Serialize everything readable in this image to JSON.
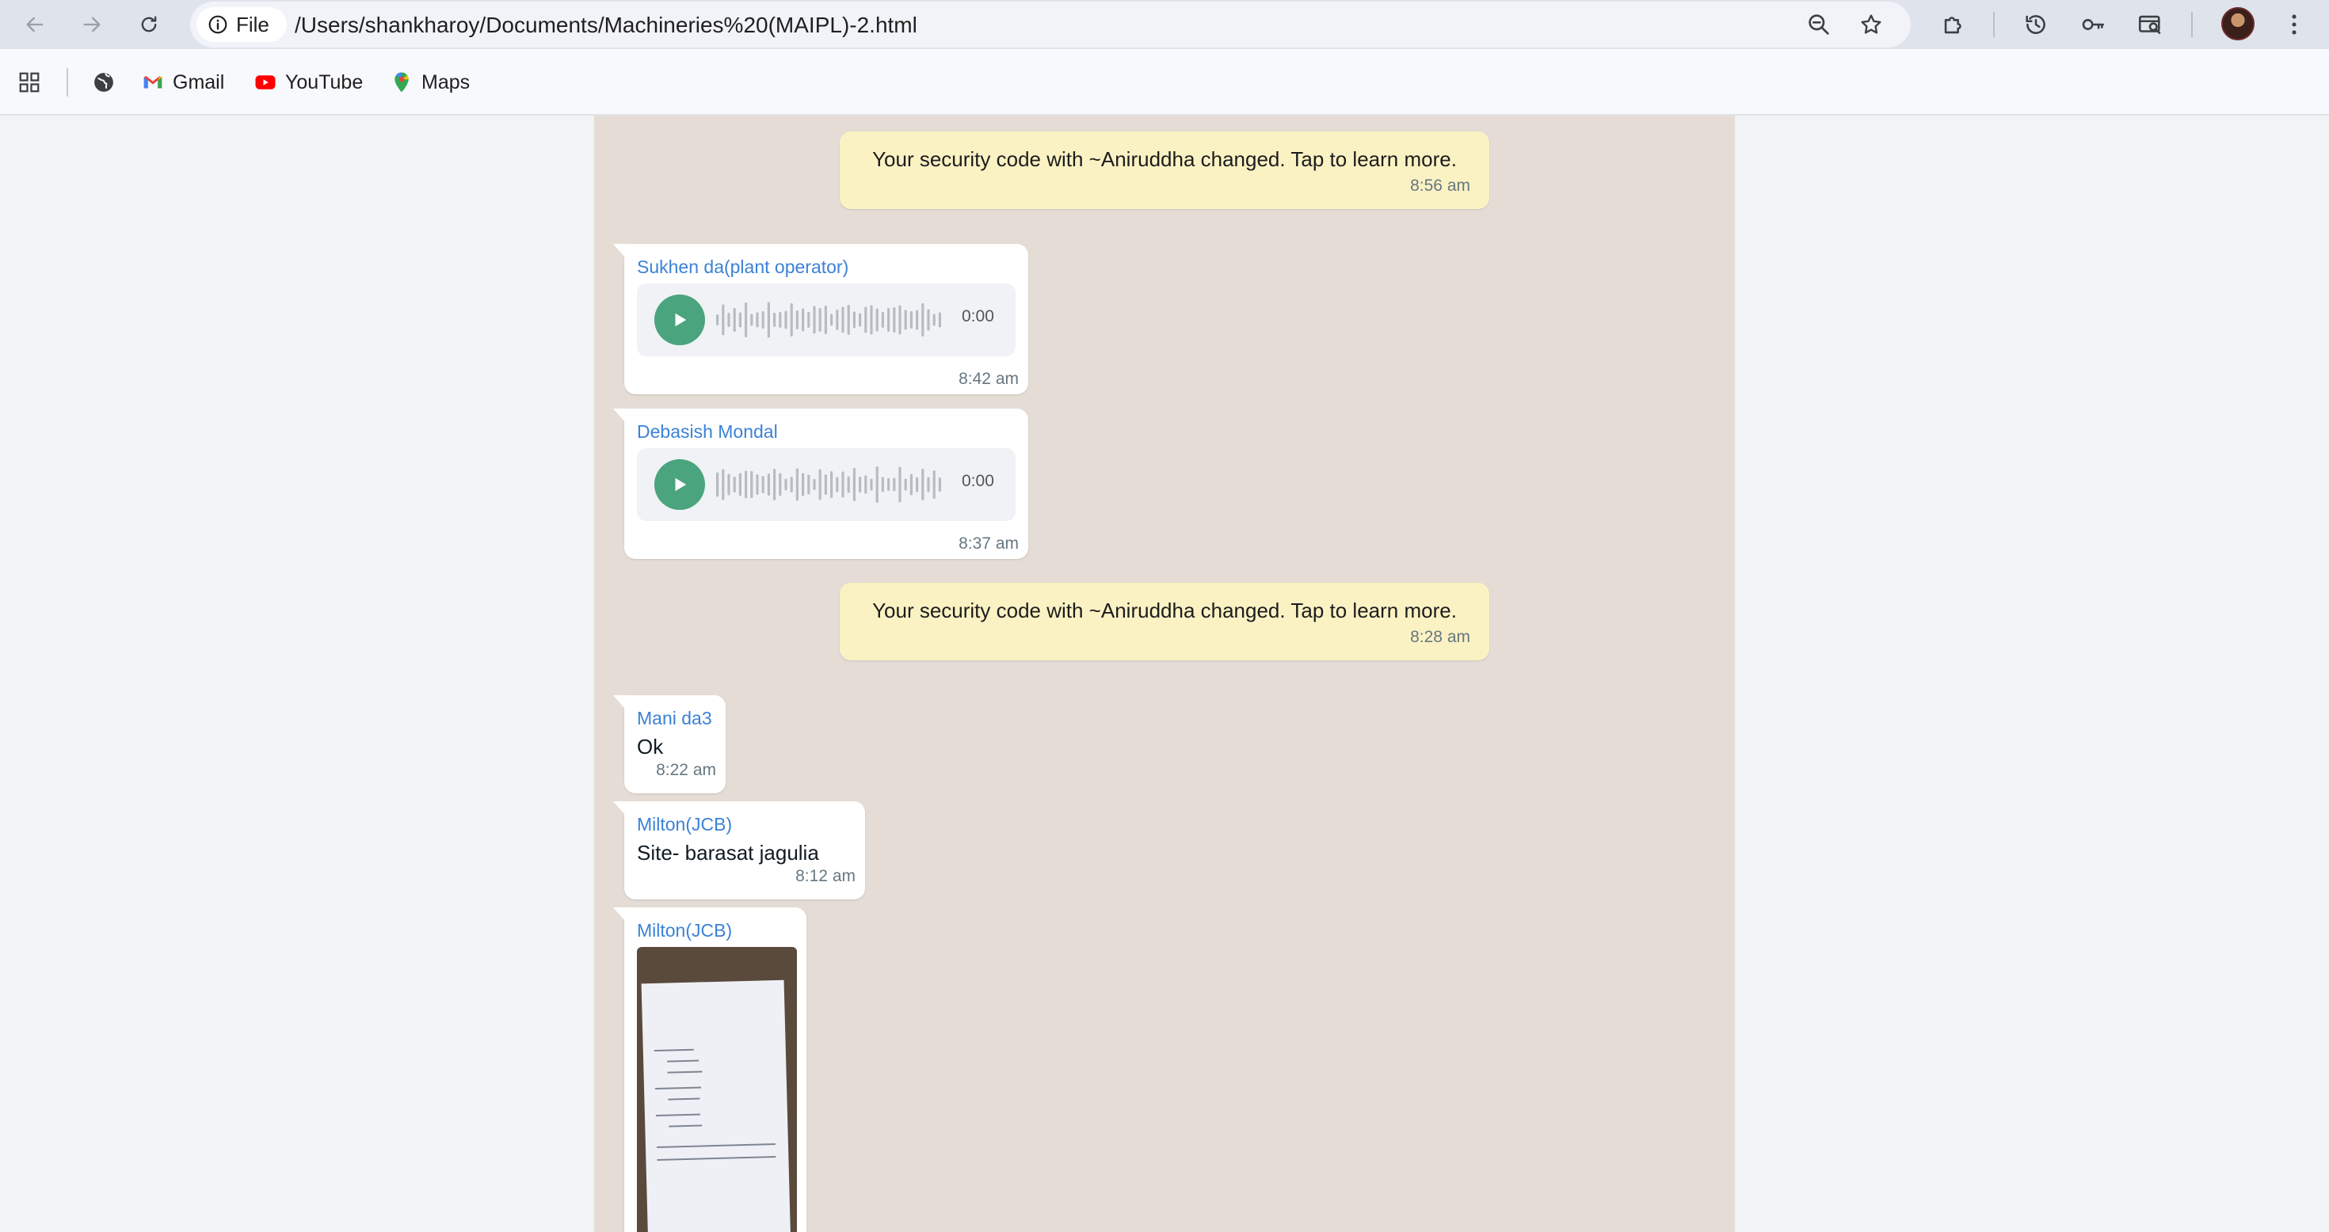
{
  "browser": {
    "site_chip_label": "File",
    "url": "/Users/shankharoy/Documents/Machineries%20(MAIPL)-2.html",
    "bookmarks": [
      {
        "label": "Gmail",
        "icon": "gmail-icon"
      },
      {
        "label": "YouTube",
        "icon": "youtube-icon"
      },
      {
        "label": "Maps",
        "icon": "maps-icon"
      }
    ]
  },
  "chat": {
    "messages": [
      {
        "type": "system",
        "text": "Your security code with ~Aniruddha changed. Tap to learn more.",
        "time": "8:56 am"
      },
      {
        "type": "audio",
        "sender": "Sukhen da(plant operator)",
        "duration": "0:00",
        "time": "8:42 am"
      },
      {
        "type": "audio",
        "sender": "Debasish Mondal",
        "duration": "0:00",
        "time": "8:37 am"
      },
      {
        "type": "system",
        "text": "Your security code with ~Aniruddha changed. Tap to learn more.",
        "time": "8:28 am"
      },
      {
        "type": "text",
        "sender": "Mani da3",
        "text": "Ok",
        "time": "8:22 am"
      },
      {
        "type": "text",
        "sender": "Milton(JCB)",
        "text": "Site- barasat jagulia",
        "time": "8:12 am"
      },
      {
        "type": "image",
        "sender": "Milton(JCB)"
      }
    ]
  },
  "colors": {
    "chat_background": "#e5ddd5",
    "system_bubble": "#fbf2c4",
    "sender_name": "#3b82d6",
    "play_button": "#4aa47d"
  }
}
